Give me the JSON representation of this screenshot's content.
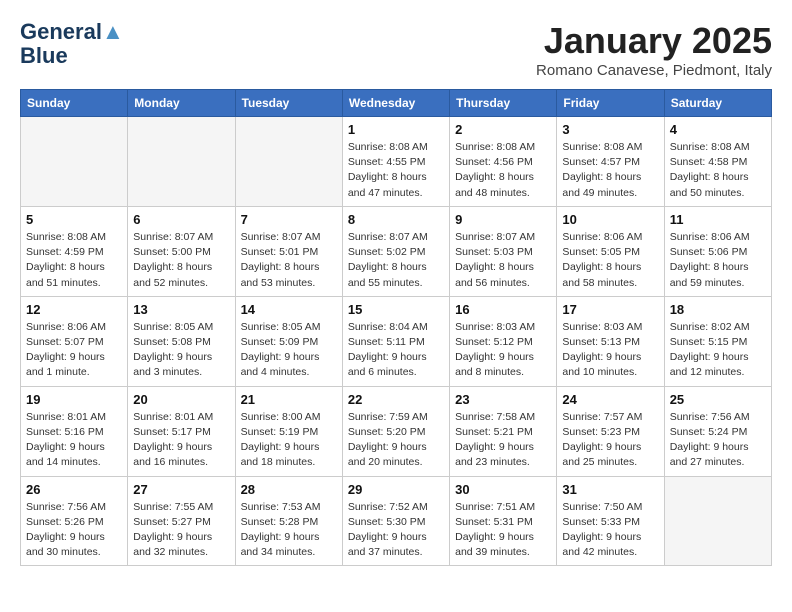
{
  "header": {
    "logo_line1": "General",
    "logo_line2": "Blue",
    "month": "January 2025",
    "location": "Romano Canavese, Piedmont, Italy"
  },
  "weekdays": [
    "Sunday",
    "Monday",
    "Tuesday",
    "Wednesday",
    "Thursday",
    "Friday",
    "Saturday"
  ],
  "weeks": [
    [
      {
        "day": "",
        "info": ""
      },
      {
        "day": "",
        "info": ""
      },
      {
        "day": "",
        "info": ""
      },
      {
        "day": "1",
        "info": "Sunrise: 8:08 AM\nSunset: 4:55 PM\nDaylight: 8 hours and 47 minutes."
      },
      {
        "day": "2",
        "info": "Sunrise: 8:08 AM\nSunset: 4:56 PM\nDaylight: 8 hours and 48 minutes."
      },
      {
        "day": "3",
        "info": "Sunrise: 8:08 AM\nSunset: 4:57 PM\nDaylight: 8 hours and 49 minutes."
      },
      {
        "day": "4",
        "info": "Sunrise: 8:08 AM\nSunset: 4:58 PM\nDaylight: 8 hours and 50 minutes."
      }
    ],
    [
      {
        "day": "5",
        "info": "Sunrise: 8:08 AM\nSunset: 4:59 PM\nDaylight: 8 hours and 51 minutes."
      },
      {
        "day": "6",
        "info": "Sunrise: 8:07 AM\nSunset: 5:00 PM\nDaylight: 8 hours and 52 minutes."
      },
      {
        "day": "7",
        "info": "Sunrise: 8:07 AM\nSunset: 5:01 PM\nDaylight: 8 hours and 53 minutes."
      },
      {
        "day": "8",
        "info": "Sunrise: 8:07 AM\nSunset: 5:02 PM\nDaylight: 8 hours and 55 minutes."
      },
      {
        "day": "9",
        "info": "Sunrise: 8:07 AM\nSunset: 5:03 PM\nDaylight: 8 hours and 56 minutes."
      },
      {
        "day": "10",
        "info": "Sunrise: 8:06 AM\nSunset: 5:05 PM\nDaylight: 8 hours and 58 minutes."
      },
      {
        "day": "11",
        "info": "Sunrise: 8:06 AM\nSunset: 5:06 PM\nDaylight: 8 hours and 59 minutes."
      }
    ],
    [
      {
        "day": "12",
        "info": "Sunrise: 8:06 AM\nSunset: 5:07 PM\nDaylight: 9 hours and 1 minute."
      },
      {
        "day": "13",
        "info": "Sunrise: 8:05 AM\nSunset: 5:08 PM\nDaylight: 9 hours and 3 minutes."
      },
      {
        "day": "14",
        "info": "Sunrise: 8:05 AM\nSunset: 5:09 PM\nDaylight: 9 hours and 4 minutes."
      },
      {
        "day": "15",
        "info": "Sunrise: 8:04 AM\nSunset: 5:11 PM\nDaylight: 9 hours and 6 minutes."
      },
      {
        "day": "16",
        "info": "Sunrise: 8:03 AM\nSunset: 5:12 PM\nDaylight: 9 hours and 8 minutes."
      },
      {
        "day": "17",
        "info": "Sunrise: 8:03 AM\nSunset: 5:13 PM\nDaylight: 9 hours and 10 minutes."
      },
      {
        "day": "18",
        "info": "Sunrise: 8:02 AM\nSunset: 5:15 PM\nDaylight: 9 hours and 12 minutes."
      }
    ],
    [
      {
        "day": "19",
        "info": "Sunrise: 8:01 AM\nSunset: 5:16 PM\nDaylight: 9 hours and 14 minutes."
      },
      {
        "day": "20",
        "info": "Sunrise: 8:01 AM\nSunset: 5:17 PM\nDaylight: 9 hours and 16 minutes."
      },
      {
        "day": "21",
        "info": "Sunrise: 8:00 AM\nSunset: 5:19 PM\nDaylight: 9 hours and 18 minutes."
      },
      {
        "day": "22",
        "info": "Sunrise: 7:59 AM\nSunset: 5:20 PM\nDaylight: 9 hours and 20 minutes."
      },
      {
        "day": "23",
        "info": "Sunrise: 7:58 AM\nSunset: 5:21 PM\nDaylight: 9 hours and 23 minutes."
      },
      {
        "day": "24",
        "info": "Sunrise: 7:57 AM\nSunset: 5:23 PM\nDaylight: 9 hours and 25 minutes."
      },
      {
        "day": "25",
        "info": "Sunrise: 7:56 AM\nSunset: 5:24 PM\nDaylight: 9 hours and 27 minutes."
      }
    ],
    [
      {
        "day": "26",
        "info": "Sunrise: 7:56 AM\nSunset: 5:26 PM\nDaylight: 9 hours and 30 minutes."
      },
      {
        "day": "27",
        "info": "Sunrise: 7:55 AM\nSunset: 5:27 PM\nDaylight: 9 hours and 32 minutes."
      },
      {
        "day": "28",
        "info": "Sunrise: 7:53 AM\nSunset: 5:28 PM\nDaylight: 9 hours and 34 minutes."
      },
      {
        "day": "29",
        "info": "Sunrise: 7:52 AM\nSunset: 5:30 PM\nDaylight: 9 hours and 37 minutes."
      },
      {
        "day": "30",
        "info": "Sunrise: 7:51 AM\nSunset: 5:31 PM\nDaylight: 9 hours and 39 minutes."
      },
      {
        "day": "31",
        "info": "Sunrise: 7:50 AM\nSunset: 5:33 PM\nDaylight: 9 hours and 42 minutes."
      },
      {
        "day": "",
        "info": ""
      }
    ]
  ]
}
